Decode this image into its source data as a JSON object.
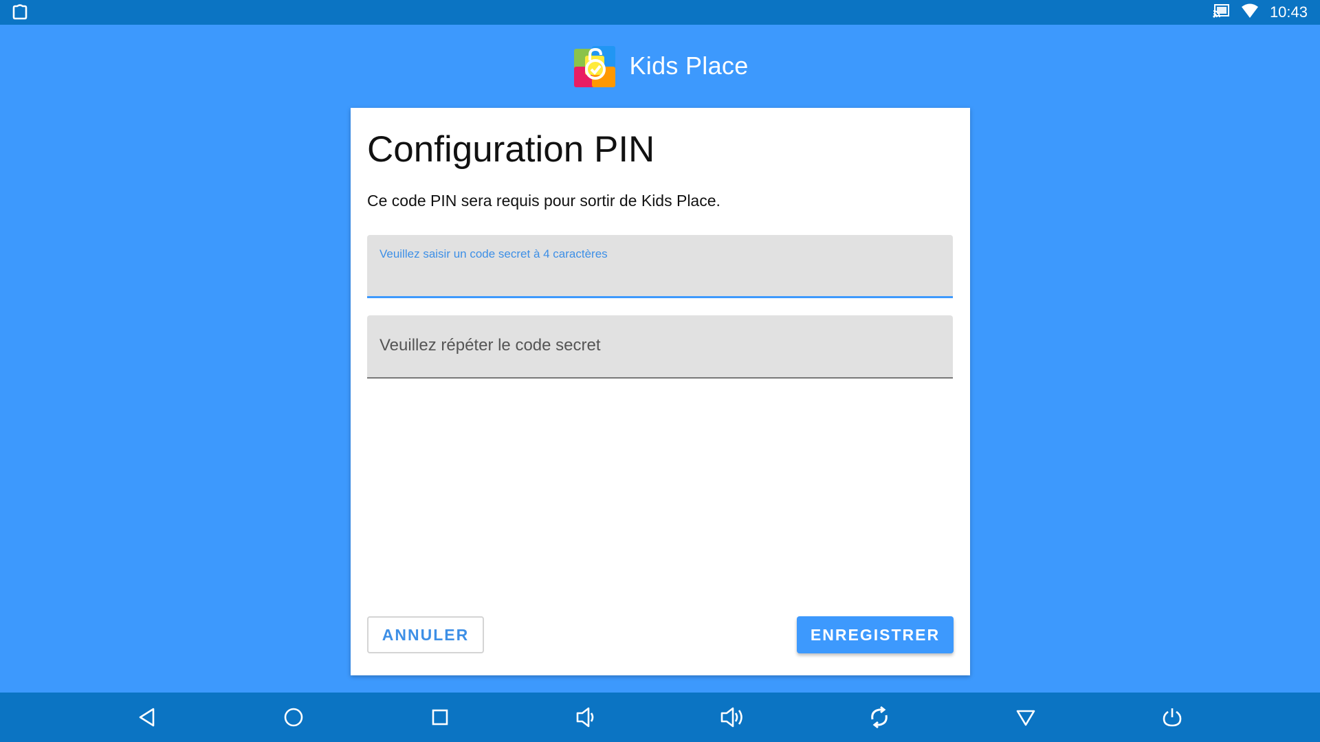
{
  "status_bar": {
    "time": "10:43",
    "icons": [
      "app-notification-icon",
      "cast-icon",
      "wifi-icon"
    ]
  },
  "header": {
    "app_name": "Kids Place",
    "logo_icon": "kids-place-logo"
  },
  "dialog": {
    "title": "Configuration PIN",
    "description": "Ce code PIN sera requis pour sortir de Kids Place.",
    "pin_field": {
      "label": "Veuillez saisir un code secret à 4 caractères",
      "value": ""
    },
    "repeat_field": {
      "placeholder": "Veuillez répéter le code secret",
      "value": ""
    },
    "cancel_label": "ANNULER",
    "save_label": "ENREGISTRER"
  },
  "nav_bar": {
    "buttons": [
      "back-icon",
      "home-icon",
      "recents-icon",
      "volume-down-icon",
      "volume-up-icon",
      "rotate-icon",
      "notifications-pull-icon",
      "power-icon"
    ]
  },
  "colors": {
    "background": "#3d99fd",
    "system_bar": "#0b74c3",
    "accent": "#3d99fd",
    "field_bg": "#e1e1e1"
  }
}
